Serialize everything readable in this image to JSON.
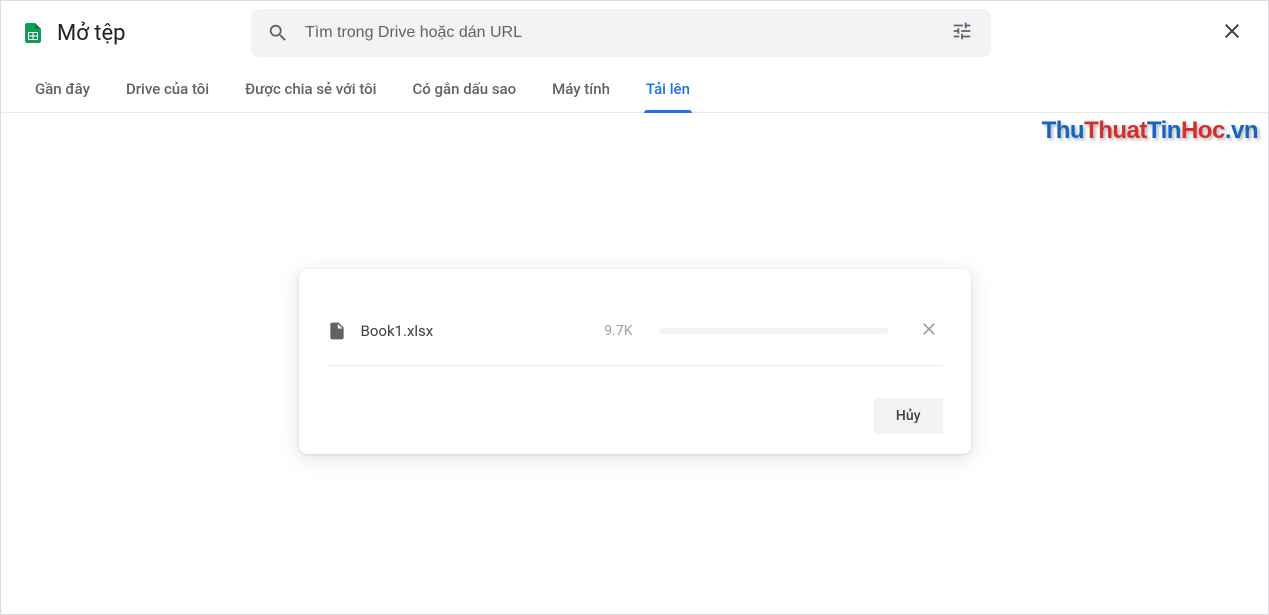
{
  "header": {
    "title": "Mở tệp",
    "search_placeholder": "Tìm trong Drive hoặc dán URL"
  },
  "tabs": [
    {
      "label": "Gần đây",
      "active": false
    },
    {
      "label": "Drive của tôi",
      "active": false
    },
    {
      "label": "Được chia sẻ với tôi",
      "active": false
    },
    {
      "label": "Có gắn dấu sao",
      "active": false
    },
    {
      "label": "Máy tính",
      "active": false
    },
    {
      "label": "Tải lên",
      "active": true
    }
  ],
  "upload": {
    "file_name": "Book1.xlsx",
    "file_size": "9.7K",
    "cancel_label": "Hủy"
  },
  "watermark": {
    "p1": "Thu",
    "p2": "Thuat",
    "p3": "Tin",
    "p4": "Hoc",
    "p5": ".vn"
  }
}
